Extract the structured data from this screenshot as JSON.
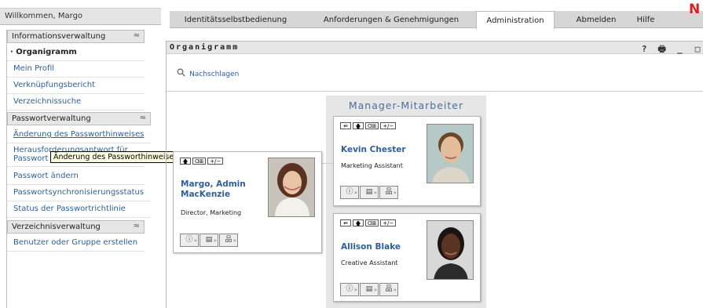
{
  "header": {
    "welcome": "Willkommen, Margo",
    "tabs": [
      {
        "label": "Identitätsselbstbedienung"
      },
      {
        "label": "Anforderungen & Genehmigungen"
      },
      {
        "label": "Administration"
      },
      {
        "label": "Abmelden"
      },
      {
        "label": "Hilfe"
      }
    ],
    "active_tab": "Administration",
    "logo_letter": "N",
    "logo_color": "#e31b23"
  },
  "sidebar": {
    "sections": [
      {
        "title": "Informationsverwaltung",
        "items": [
          {
            "label": "· Organigramm"
          },
          {
            "label": "Mein Profil"
          },
          {
            "label": "Verknüpfungsbericht"
          },
          {
            "label": "Verzeichnissuche"
          }
        ]
      },
      {
        "title": "Passwortverwaltung",
        "items": [
          {
            "label": "Änderung des Passworthinweises"
          },
          {
            "label": "Herausforderungsantwort für Passwort"
          },
          {
            "label": "Passwort ändern"
          },
          {
            "label": "Passwortsynchronisierungsstatus"
          },
          {
            "label": "Status der Passwortrichtlinie"
          }
        ]
      },
      {
        "title": "Verzeichnisverwaltung",
        "items": [
          {
            "label": "Benutzer oder Gruppe erstellen"
          }
        ]
      }
    ],
    "collapse_glyph": "≈",
    "tooltip": "Änderung des Passworthinweises"
  },
  "portlet": {
    "title": "Organigramm",
    "tools": [
      "?",
      "🖶",
      "_",
      "□"
    ],
    "lookup_label": "Nachschlagen",
    "relationship_title": "Manager-Mitarbeiter",
    "manager": {
      "name_line1": "Margo, Admin",
      "name_line2": "MacKenzie",
      "title": "Director, Marketing",
      "buttons": [
        "🡅",
        "ᗡ⊞",
        "+/−"
      ]
    },
    "employees": [
      {
        "name": "Kevin Chester",
        "title": "Marketing Assistant",
        "buttons": [
          "⇚",
          "🡅",
          "ᗡ⊞",
          "+/−"
        ]
      },
      {
        "name": "Allison Blake",
        "title": "Creative Assistant",
        "buttons": [
          "⇚",
          "🡅",
          "ᗡ⊞",
          "+/−"
        ]
      }
    ],
    "action_buttons": [
      "ⓘ",
      "▤",
      "品"
    ]
  }
}
